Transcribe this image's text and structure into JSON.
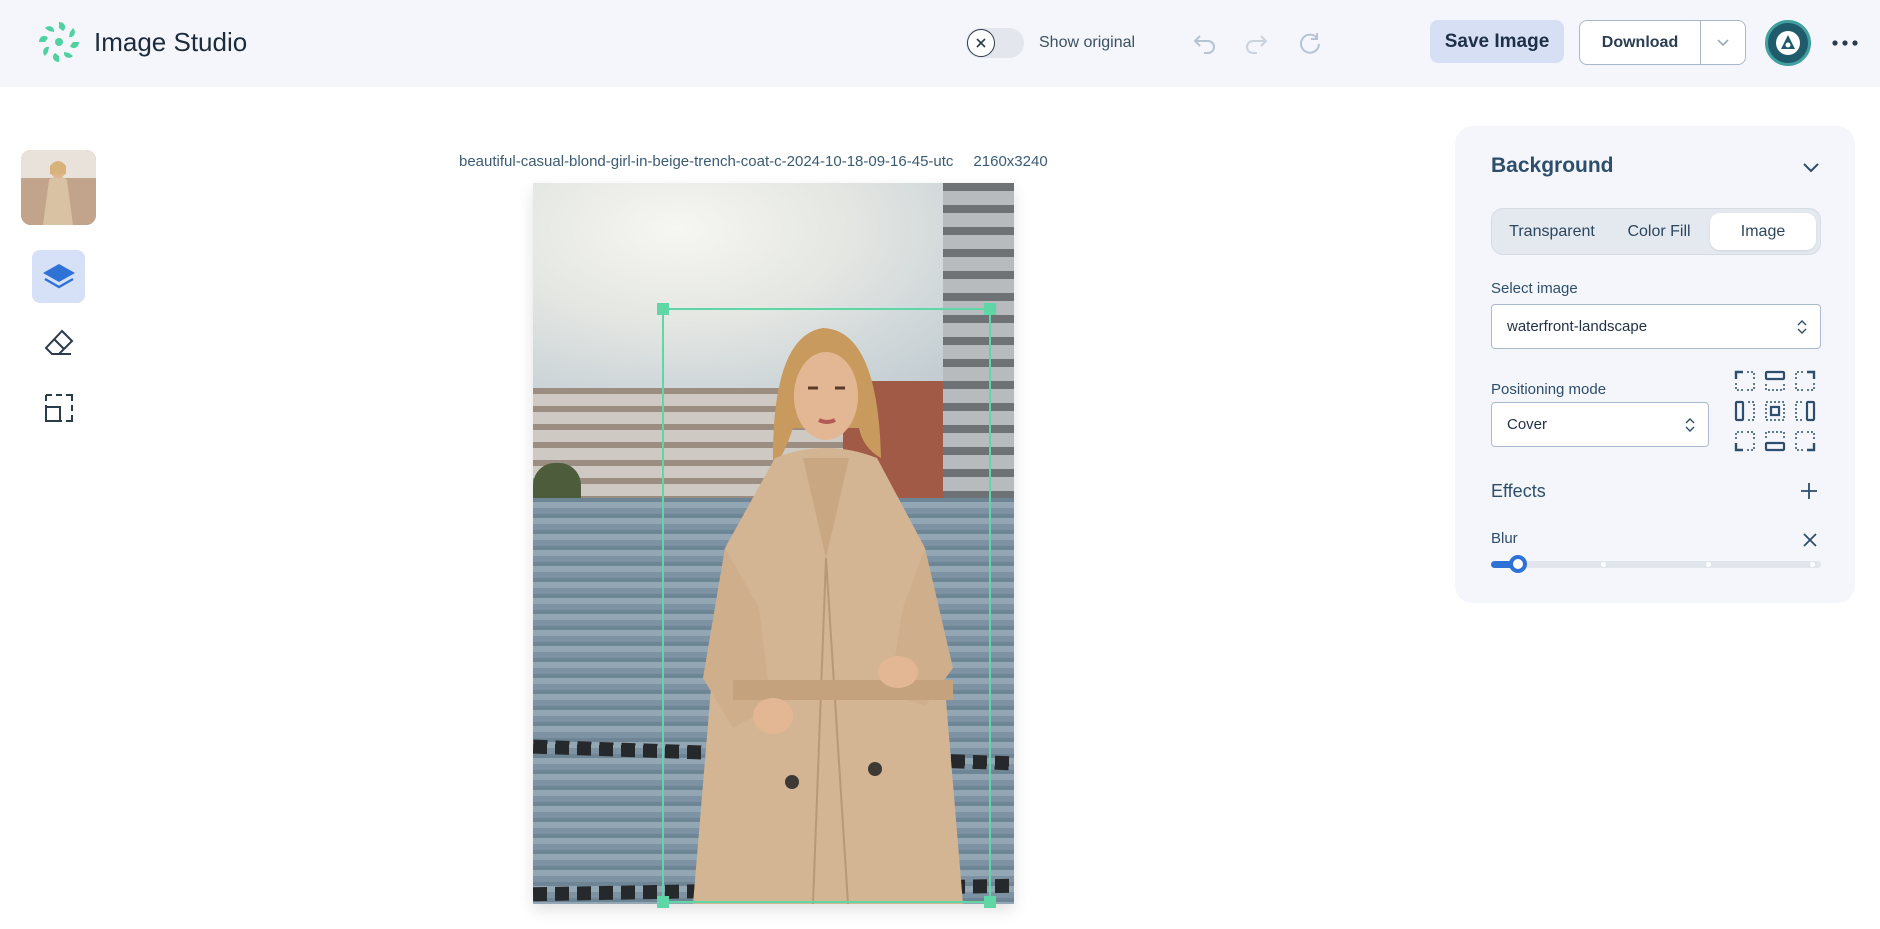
{
  "app": {
    "title": "Image Studio"
  },
  "header": {
    "show_original_label": "Show original",
    "show_original_on": false,
    "undo_icon": "undo-icon",
    "redo_icon": "redo-icon",
    "reset_icon": "reset-icon",
    "save_label": "Save Image",
    "download_label": "Download",
    "more_icon": "more-icon"
  },
  "tools": {
    "items": [
      {
        "name": "layers",
        "active": true
      },
      {
        "name": "eraser",
        "active": false
      },
      {
        "name": "crop",
        "active": false
      }
    ]
  },
  "canvas": {
    "filename": "beautiful-casual-blond-girl-in-beige-trench-coat-c-2024-10-18-09-16-45-utc",
    "dimensions": "2160x3240"
  },
  "panel": {
    "title": "Background",
    "tabs": [
      {
        "label": "Transparent",
        "selected": false
      },
      {
        "label": "Color Fill",
        "selected": false
      },
      {
        "label": "Image",
        "selected": true
      }
    ],
    "select_image_label": "Select image",
    "select_image_value": "waterfront-landscape",
    "positioning_label": "Positioning mode",
    "positioning_value": "Cover",
    "effects_title": "Effects",
    "blur_label": "Blur",
    "blur_value_fraction": 0.07
  },
  "colors": {
    "accent": "#2f72d6",
    "selection": "#5fd6a6",
    "brand": "#4fd1a0",
    "save_button_bg": "#d7dff5"
  }
}
